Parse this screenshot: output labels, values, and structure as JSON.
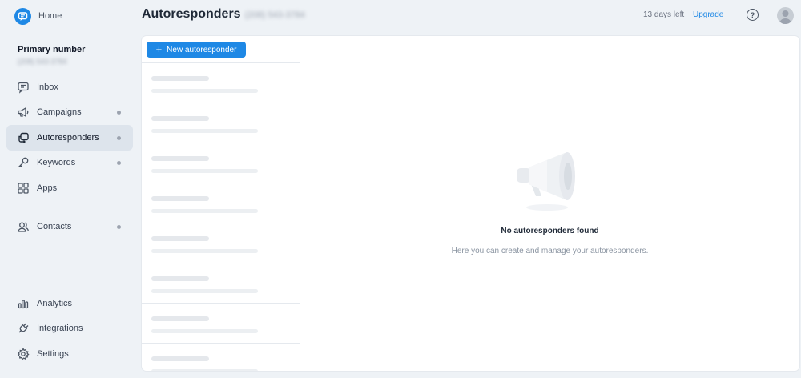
{
  "sidebar": {
    "home_label": "Home",
    "primary_title": "Primary number",
    "primary_value": "(208) 543-3784",
    "items": [
      {
        "label": "Inbox",
        "icon": "inbox-icon"
      },
      {
        "label": "Campaigns",
        "icon": "megaphone-icon"
      },
      {
        "label": "Autoresponders",
        "icon": "autoresponder-icon"
      },
      {
        "label": "Keywords",
        "icon": "key-icon"
      },
      {
        "label": "Apps",
        "icon": "apps-icon"
      },
      {
        "label": "Contacts",
        "icon": "contacts-icon"
      },
      {
        "label": "Analytics",
        "icon": "analytics-icon"
      },
      {
        "label": "Integrations",
        "icon": "plug-icon"
      },
      {
        "label": "Settings",
        "icon": "gear-icon"
      }
    ]
  },
  "header": {
    "title": "Autoresponders",
    "title_number": "(208) 543-3784",
    "trial": "13 days left",
    "upgrade": "Upgrade",
    "help_glyph": "?"
  },
  "list": {
    "new_button_plus": "+",
    "new_button": "New autoresponder"
  },
  "empty_state": {
    "title": "No autoresponders found",
    "subtitle": "Here you can create and manage your autoresponders."
  },
  "colors": {
    "accent": "#1e88e5",
    "background": "#eef2f6",
    "active_item": "#dde4ec"
  }
}
